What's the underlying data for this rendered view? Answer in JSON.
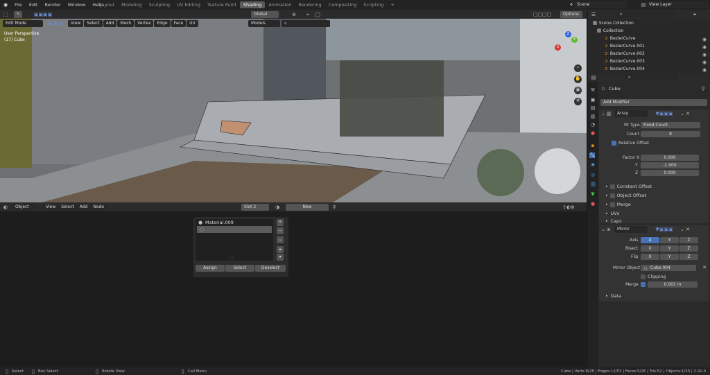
{
  "topbar": {
    "menus": [
      "File",
      "Edit",
      "Render",
      "Window",
      "Help"
    ],
    "workspaces": [
      "Layout",
      "Modeling",
      "Sculpting",
      "UV Editing",
      "Texture Paint",
      "Shading",
      "Animation",
      "Rendering",
      "Compositing",
      "Scripting"
    ],
    "active_workspace": "Shading",
    "add_tab": "+",
    "scene": "Scene",
    "view_layer": "View Layer"
  },
  "viewport": {
    "mode": "Edit Mode",
    "menus": [
      "View",
      "Select",
      "Add",
      "Mesh",
      "Vertex",
      "Edge",
      "Face",
      "UV"
    ],
    "orientation": "Global",
    "shading_set": "Models",
    "perspective_label": "User Perspective",
    "object_label": "(17) Cube",
    "options": "Options",
    "axes": {
      "x": "X",
      "y": "Y",
      "z": "Z"
    }
  },
  "node_editor": {
    "object_type": "Object",
    "menus": [
      "View",
      "Select",
      "Add",
      "Node"
    ],
    "slot": "Slot 2",
    "new_label": "New",
    "materials": [
      "Material.009",
      ""
    ],
    "buttons": [
      "Assign",
      "Select",
      "Deselect"
    ]
  },
  "outliner": {
    "root": "Scene Collection",
    "collection": "Collection",
    "items": [
      "BezierCurve",
      "BezierCurve.001",
      "BezierCurve.002",
      "BezierCurve.003",
      "BezierCurve.004"
    ]
  },
  "properties": {
    "object": "Cube",
    "add_modifier": "Add Modifier",
    "array": {
      "name": "Array",
      "fit_type_label": "Fit Type",
      "fit_type": "Fixed Count",
      "count_label": "Count",
      "count": "8",
      "relative_offset": "Relative Offset",
      "factor_label": "Factor X",
      "y_label": "Y",
      "z_label": "Z",
      "factor_x": "0.000",
      "factor_y": "-1.000",
      "factor_z": "0.000",
      "constant_offset": "Constant Offset",
      "object_offset": "Object Offset",
      "merge": "Merge",
      "uvs": "UVs",
      "caps": "Caps"
    },
    "mirror": {
      "name": "Mirror",
      "axis_label": "Axis",
      "bisect_label": "Bisect",
      "flip_label": "Flip",
      "x": "X",
      "y": "Y",
      "z": "Z",
      "mirror_object_label": "Mirror Object",
      "mirror_object": "Cube.004",
      "clipping": "Clipping",
      "merge_label": "Merge",
      "merge_value": "0.001 m",
      "data": "Data"
    }
  },
  "statusbar": {
    "select": "Select",
    "box_select": "Box Select",
    "rotate": "Rotate View",
    "call_menu": "Call Menu",
    "stats": "Cube | Verts:8/28 | Edges:12/52 | Faces:5/26 | Tris:52 | Objects:1/33 | 2.91.0"
  }
}
